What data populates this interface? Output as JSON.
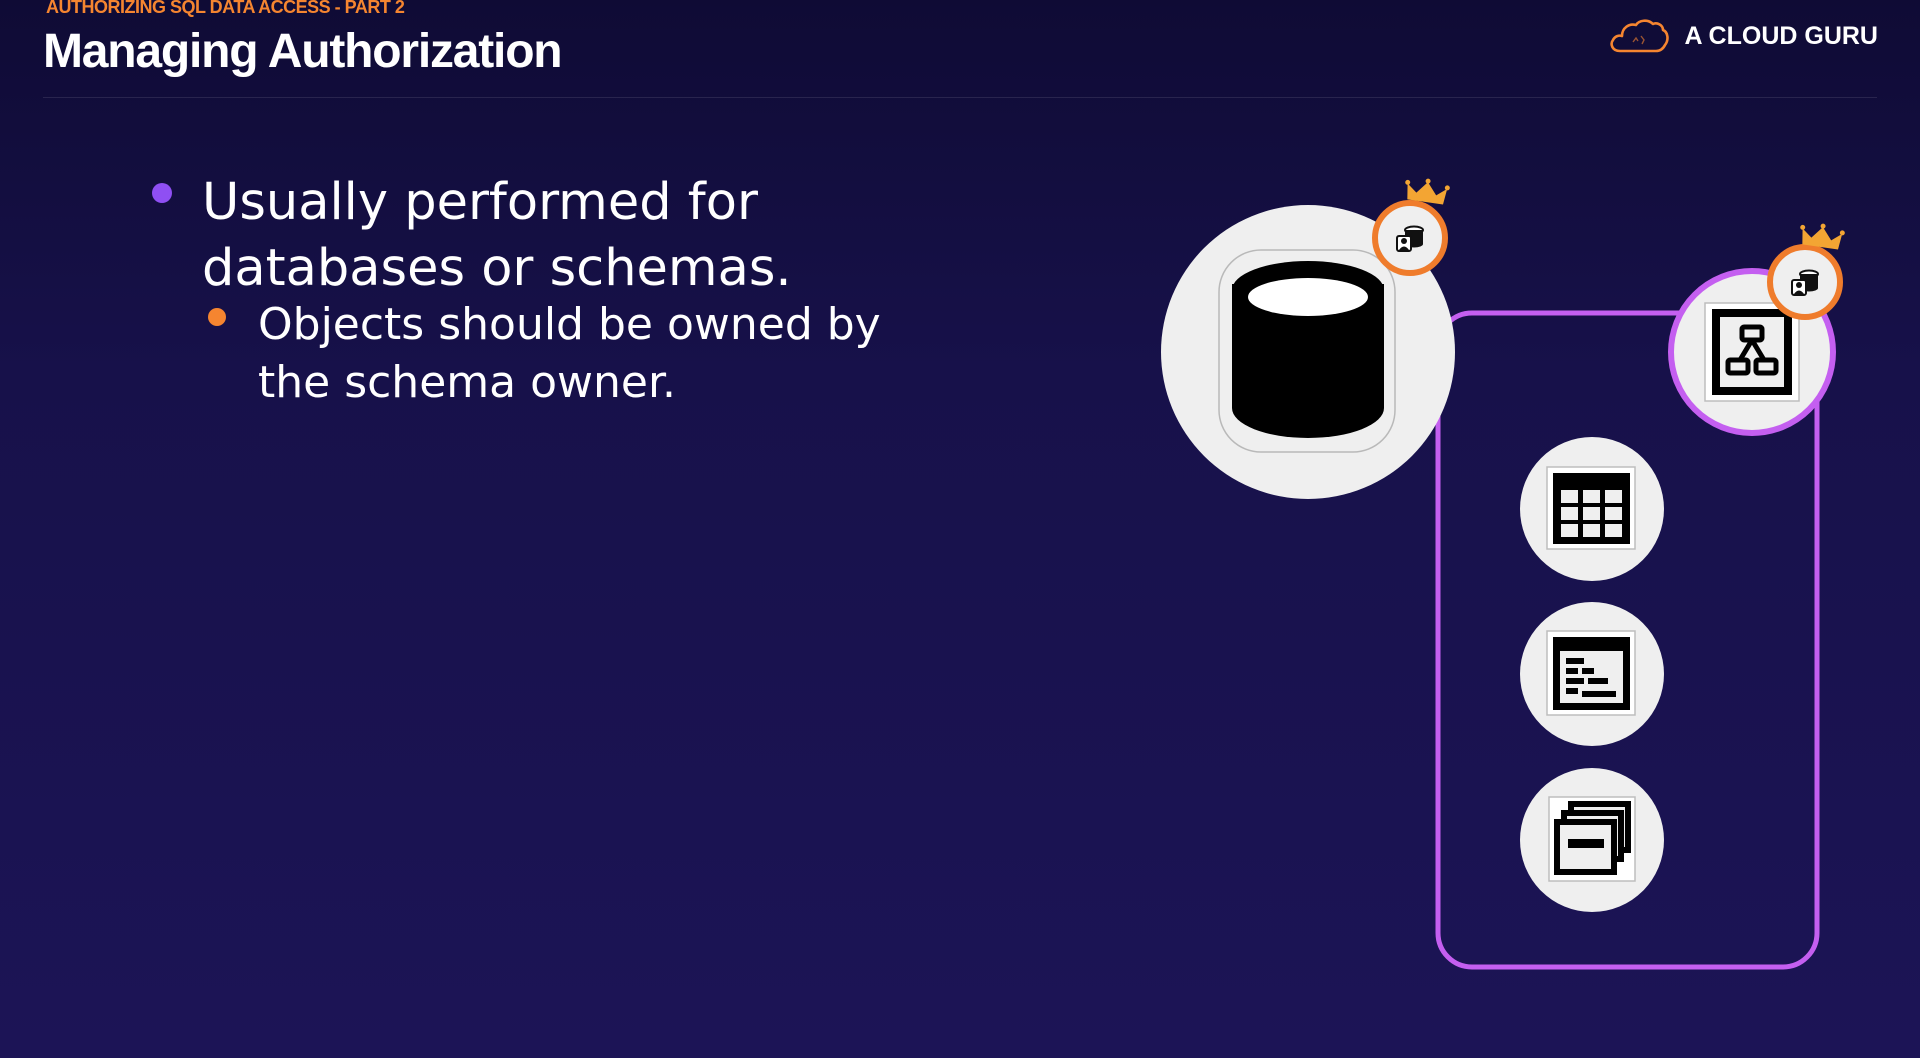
{
  "header": {
    "kicker": "AUTHORIZING SQL DATA ACCESS - PART 2",
    "title": "Managing Authorization"
  },
  "brand": {
    "name": "A CLOUD GURU",
    "logo_icon": "cloud-logo-icon",
    "accent": "#f58530"
  },
  "bullets": [
    {
      "text": "Usually performed for databases or schemas.",
      "color": "#8f4ff3"
    },
    {
      "text": "Objects should be owned by the schema owner.",
      "color": "#f58530"
    }
  ],
  "diagram": {
    "database_icon": "database-icon",
    "schema_icon": "schema-icon",
    "owner_badge_icon": "owner-crown-icon",
    "objects": [
      "table-icon",
      "view-icon",
      "stored-objects-icon"
    ],
    "colors": {
      "schema_border": "#c45ff0",
      "owner_ring": "#ef7c2c",
      "crown": "#f3a533",
      "circle_fill": "#efefef"
    }
  }
}
